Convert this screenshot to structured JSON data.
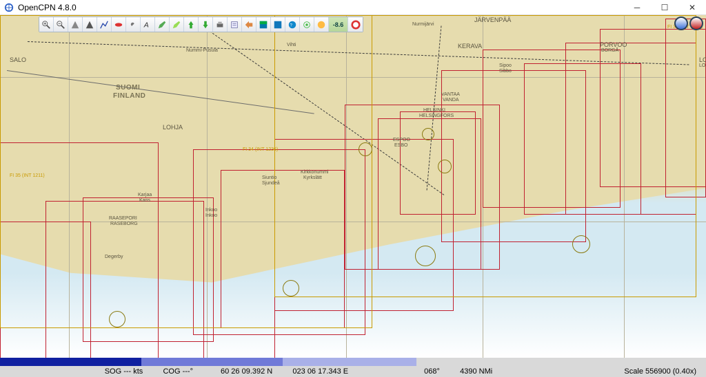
{
  "window": {
    "title": "OpenCPN 4.8.0"
  },
  "toolbar": {
    "icons": [
      "zoom-in-icon",
      "zoom-out-icon",
      "scale-chart-icon",
      "route-icon",
      "track-icon",
      "ship-icon",
      "wrench-icon",
      "text-icon",
      "pencil-icon",
      "highlight-icon",
      "upload-icon",
      "download-icon",
      "print-icon",
      "notes-icon",
      "select-icon",
      "color-icon",
      "panel-icon",
      "ais-icon",
      "target-icon",
      "tide-icon"
    ],
    "depth_value": "-8.6",
    "help_icon": "lifebuoy-icon"
  },
  "mode": {
    "left_color": "#2b60c7",
    "right_color": "#b01818"
  },
  "map_labels": {
    "suomi": "SUOMI",
    "finland": "FINLAND",
    "salo": "SALO",
    "nummi": "Nummi-Pusula",
    "vihti": "Vihti",
    "lohja": "LOHJA",
    "nurmijarvi": "Nurmijärvi",
    "jarvenpaa": "JÄRVENPÄÄ",
    "kerava": "KERAVA",
    "vantaa1": "VANTAA",
    "vantaa2": "VANDA",
    "helsinki1": "HELSINKI",
    "helsinki2": "HELSINGFORS",
    "espoo1": "ESPOO",
    "espoo2": "ESBO",
    "sipoo1": "Sipoo",
    "sipoo2": "Sibbo",
    "porvoo1": "PORVOO",
    "porvoo2": "BORGÅ",
    "kirkkonummi1": "Kirkkonummi",
    "kirkkonummi2": "Kyrkslätt",
    "siuntio1": "Siuntio",
    "siuntio2": "Sjundeå",
    "inkoo1": "Inkoo",
    "inkoo2": "Inkoo",
    "raasepori1": "RAASEPORI",
    "raasepori2": "RASEBORG",
    "degerby": "Degerby",
    "karis1": "Karjaa",
    "karis2": "Karis",
    "loviisa1": "LO",
    "loviisa2": "LO"
  },
  "chart_codes": {
    "fi34": "FI 34 (INT 1236)",
    "fi35": "FI 35 (INT 1211)",
    "fi36": "FI 36 (INT 1236)"
  },
  "status": {
    "sog": "SOG --- kts",
    "cog": "COG ---°",
    "lat": "60 26 09.392 N",
    "lon": "023 06 17.343 E",
    "brg": "068°",
    "rng": "4390 NMi",
    "scale": "Scale 556900 (0.40x)"
  }
}
